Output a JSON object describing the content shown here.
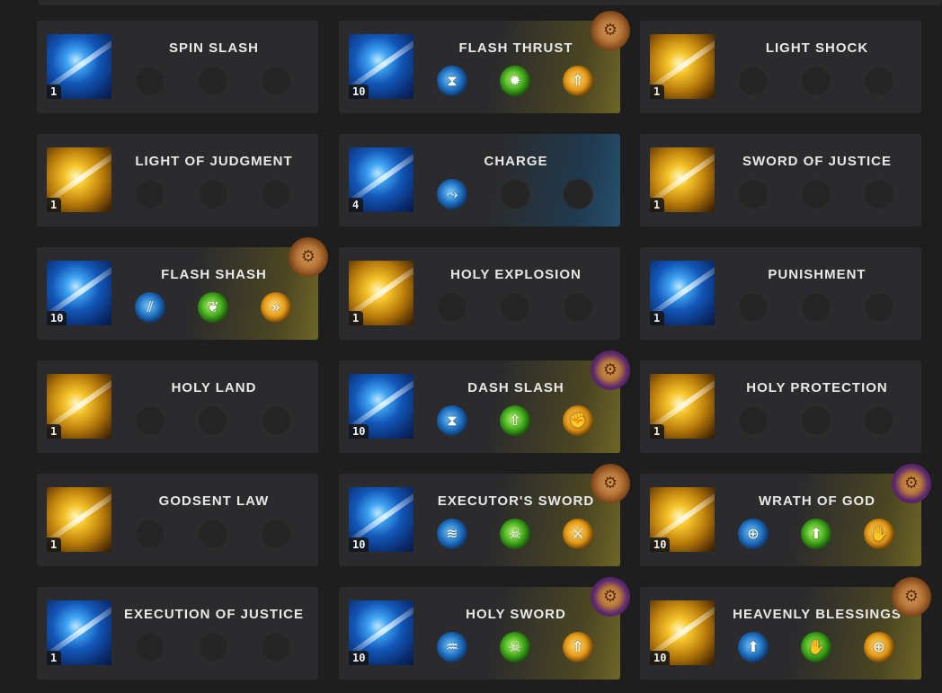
{
  "colors": {
    "background": "#1e1e1f",
    "card": "#2b2b2d",
    "gold_accent": "#6e6626",
    "blue_accent": "#28506e",
    "text": "#e8e8e8"
  },
  "skills": [
    {
      "name": "SPIN SLASH",
      "level": "1",
      "icon": "blue-crescent-slash-icon",
      "theme": "blue",
      "highlight": "none",
      "gem": "none",
      "runes": []
    },
    {
      "name": "FLASH THRUST",
      "level": "10",
      "icon": "blue-thrust-icon",
      "theme": "blue",
      "highlight": "gold",
      "gem": "orange",
      "gem_icon": "tripod-gem-icon",
      "runes": [
        {
          "color": "blue",
          "icon": "hourglass-down-icon",
          "glyph": "⧗"
        },
        {
          "color": "green",
          "icon": "green-burst-icon",
          "glyph": "✹"
        },
        {
          "color": "orange",
          "icon": "orange-up-arrow-icon",
          "glyph": "⇑"
        }
      ]
    },
    {
      "name": "LIGHT SHOCK",
      "level": "1",
      "icon": "gold-shock-icon",
      "theme": "gold",
      "highlight": "none",
      "gem": "none",
      "runes": []
    },
    {
      "name": "LIGHT OF JUDGMENT",
      "level": "1",
      "icon": "gold-judgment-icon",
      "theme": "gold",
      "highlight": "none",
      "gem": "none",
      "runes": []
    },
    {
      "name": "CHARGE",
      "level": "4",
      "icon": "blue-charge-icon",
      "theme": "blue",
      "highlight": "blue",
      "gem": "none",
      "runes": [
        {
          "color": "blue",
          "icon": "running-figure-icon",
          "glyph": "⤳"
        }
      ]
    },
    {
      "name": "SWORD OF JUSTICE",
      "level": "1",
      "icon": "gold-sword-icon",
      "theme": "gold",
      "highlight": "none",
      "gem": "none",
      "runes": []
    },
    {
      "name": "FLASH SHASH",
      "level": "10",
      "icon": "blue-crescent-icon",
      "theme": "blue",
      "highlight": "gold",
      "gem": "orange",
      "gem_icon": "tripod-gem-icon",
      "runes": [
        {
          "color": "blue",
          "icon": "claw-slash-icon",
          "glyph": "⫽"
        },
        {
          "color": "green",
          "icon": "green-feather-icon",
          "glyph": "❦"
        },
        {
          "color": "orange",
          "icon": "orange-fast-forward-icon",
          "glyph": "»"
        }
      ]
    },
    {
      "name": "HOLY EXPLOSION",
      "level": "1",
      "icon": "gold-explosion-icon",
      "theme": "gold",
      "highlight": "none",
      "gem": "none",
      "runes": []
    },
    {
      "name": "PUNISHMENT",
      "level": "1",
      "icon": "blue-punishment-icon",
      "theme": "blue",
      "highlight": "none",
      "gem": "none",
      "runes": []
    },
    {
      "name": "HOLY LAND",
      "level": "1",
      "icon": "gold-holy-land-icon",
      "theme": "gold",
      "highlight": "none",
      "gem": "none",
      "runes": []
    },
    {
      "name": "DASH SLASH",
      "level": "10",
      "icon": "blue-dash-icon",
      "theme": "blue",
      "highlight": "gold",
      "gem": "purple",
      "gem_icon": "tripod-gem-icon",
      "runes": [
        {
          "color": "blue",
          "icon": "hourglass-down-icon",
          "glyph": "⧗"
        },
        {
          "color": "green",
          "icon": "green-up-arrow-icon",
          "glyph": "⇧"
        },
        {
          "color": "orange",
          "icon": "orange-fist-icon",
          "glyph": "✊"
        }
      ]
    },
    {
      "name": "HOLY PROTECTION",
      "level": "1",
      "icon": "gold-protection-icon",
      "theme": "gold",
      "highlight": "none",
      "gem": "none",
      "runes": []
    },
    {
      "name": "GODSENT LAW",
      "level": "1",
      "icon": "gold-law-icon",
      "theme": "gold",
      "highlight": "none",
      "gem": "none",
      "runes": []
    },
    {
      "name": "EXECUTOR'S SWORD",
      "level": "10",
      "icon": "blue-executor-icon",
      "theme": "blue",
      "highlight": "gold",
      "gem": "orange",
      "gem_icon": "tripod-gem-icon",
      "runes": [
        {
          "color": "blue",
          "icon": "wind-wave-icon",
          "glyph": "≋"
        },
        {
          "color": "green",
          "icon": "green-skull-icon",
          "glyph": "☠"
        },
        {
          "color": "orange",
          "icon": "orange-crossed-swords-icon",
          "glyph": "⚔"
        }
      ]
    },
    {
      "name": "WRATH OF GOD",
      "level": "10",
      "icon": "gold-wrath-icon",
      "theme": "gold",
      "highlight": "gold",
      "gem": "purple",
      "gem_icon": "tripod-gem-icon",
      "runes": [
        {
          "color": "blue",
          "icon": "crosshair-icon",
          "glyph": "⊕"
        },
        {
          "color": "green",
          "icon": "green-orb-up-icon",
          "glyph": "⬆"
        },
        {
          "color": "orange",
          "icon": "orange-claw-icon",
          "glyph": "✋"
        }
      ]
    },
    {
      "name": "EXECUTION OF JUSTICE",
      "level": "1",
      "icon": "blue-execution-icon",
      "theme": "blue",
      "highlight": "none",
      "gem": "none",
      "runes": []
    },
    {
      "name": "HOLY SWORD",
      "level": "10",
      "icon": "blue-holy-sword-icon",
      "theme": "blue",
      "highlight": "gold",
      "gem": "purple",
      "gem_icon": "tripod-gem-icon",
      "runes": [
        {
          "color": "blue",
          "icon": "blue-splash-icon",
          "glyph": "♒"
        },
        {
          "color": "green",
          "icon": "green-skull-icon",
          "glyph": "☠"
        },
        {
          "color": "orange",
          "icon": "orange-up-arrow-icon",
          "glyph": "⇑"
        }
      ]
    },
    {
      "name": "HEAVENLY BLESSINGS",
      "level": "10",
      "icon": "gold-angel-icon",
      "theme": "gold",
      "highlight": "gold",
      "gem": "orange",
      "gem_icon": "tripod-gem-icon",
      "runes": [
        {
          "color": "blue",
          "icon": "blue-orb-up-icon",
          "glyph": "⬆"
        },
        {
          "color": "green",
          "icon": "green-hand-icon",
          "glyph": "✋"
        },
        {
          "color": "orange",
          "icon": "orange-crosshair-icon",
          "glyph": "⊕"
        }
      ]
    }
  ]
}
